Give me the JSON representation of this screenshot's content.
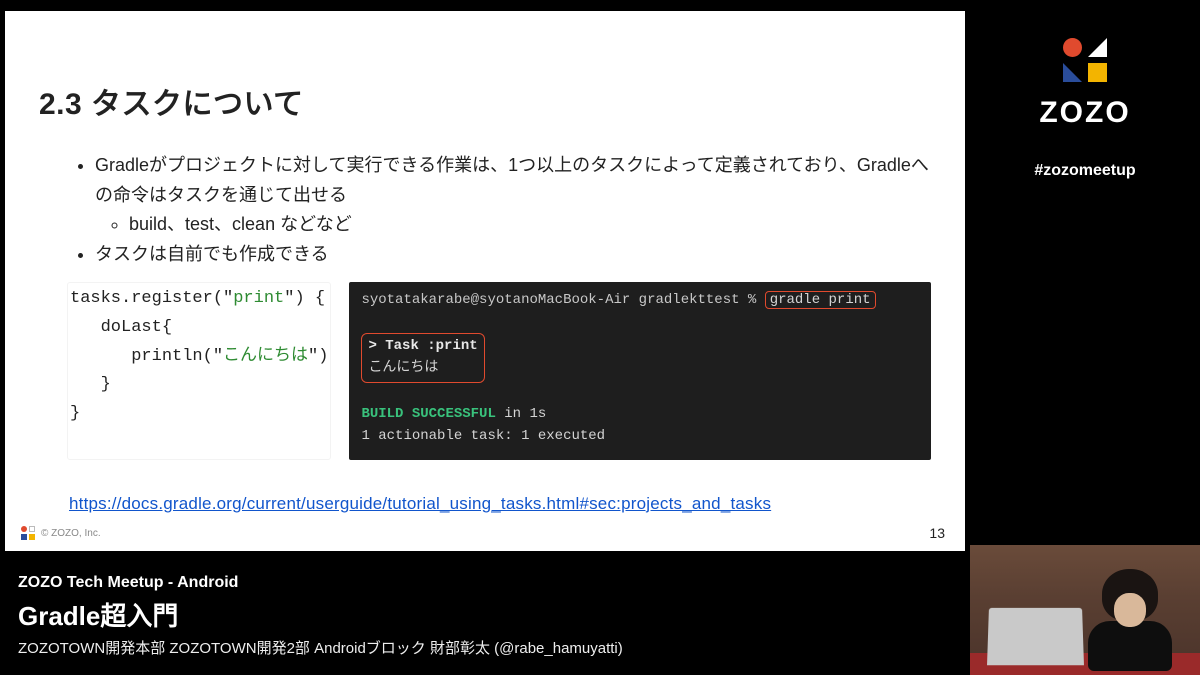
{
  "sidebar": {
    "brand": "ZOZO",
    "hashtag": "#zozomeetup"
  },
  "lower_third": {
    "event": "ZOZO Tech Meetup - Android",
    "talk_title": "Gradle超入門",
    "speaker_line": "ZOZOTOWN開発本部 ZOZOTOWN開発2部 Androidブロック 財部彰太 (@rabe_hamuyatti)"
  },
  "slide": {
    "heading": "2.3 タスクについて",
    "bullets": {
      "b1": "Gradleがプロジェクトに対して実行できる作業は、1つ以上のタスクによって定義されており、Gradleへの命令はタスクを通じて出せる",
      "b1a": "build、test、clean などなど",
      "b2": "タスクは自前でも作成できる"
    },
    "code": {
      "l1a": "tasks.register(\"",
      "l1s": "print",
      "l1b": "\") {",
      "l2": "   doLast{",
      "l3a": "      println(\"",
      "l3s": "こんにちは",
      "l3b": "\")",
      "l4": "   }",
      "l5": "}"
    },
    "terminal": {
      "prompt": "syotatakarabe@syotanoMacBook-Air gradlekttest % ",
      "cmd": "gradle print",
      "task_header": "> Task :print",
      "task_output": "こんにちは",
      "build_ok": "BUILD SUCCESSFUL",
      "build_time": " in 1s",
      "summary": "1 actionable task: 1 executed"
    },
    "link": "https://docs.gradle.org/current/userguide/tutorial_using_tasks.html#sec:projects_and_tasks",
    "footer_copyright": "© ZOZO, Inc.",
    "page": "13"
  }
}
